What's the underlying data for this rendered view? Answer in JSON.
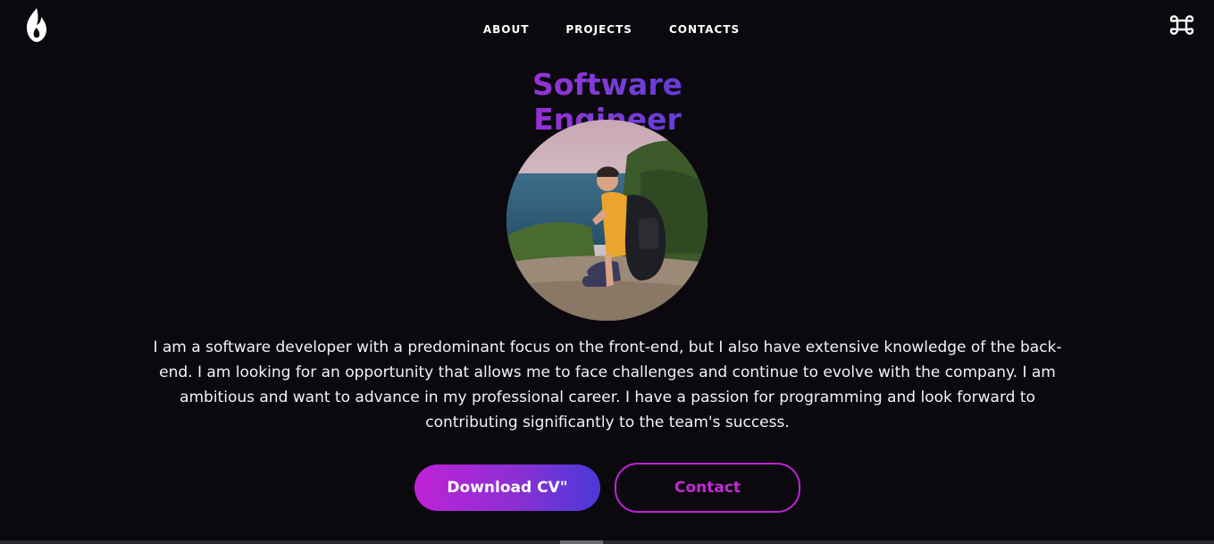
{
  "header": {
    "logo_icon": "flame-logo-icon",
    "nav": [
      {
        "label": "ABOUT"
      },
      {
        "label": "PROJECTS"
      },
      {
        "label": "CONTACTS"
      }
    ],
    "menu_icon": "command-key-icon"
  },
  "hero": {
    "title": "Software Engineer",
    "title_gradient": [
      "#b522d9",
      "#4a3ad8"
    ],
    "avatar": "profile-photo",
    "bio": "I am a software developer with a predominant focus on the front-end, but I also have extensive knowledge of the back-end. I am looking for an opportunity that allows me to face challenges and continue to evolve with the company. I am ambitious and want to advance in my professional career. I have a passion for programming and look forward to contributing significantly to the team's success."
  },
  "actions": {
    "download_label": "Download CV\"",
    "contact_label": "Contact"
  },
  "colors": {
    "background": "#0b090e",
    "accent": "#c022d6",
    "accent_end": "#4a3ad8"
  }
}
